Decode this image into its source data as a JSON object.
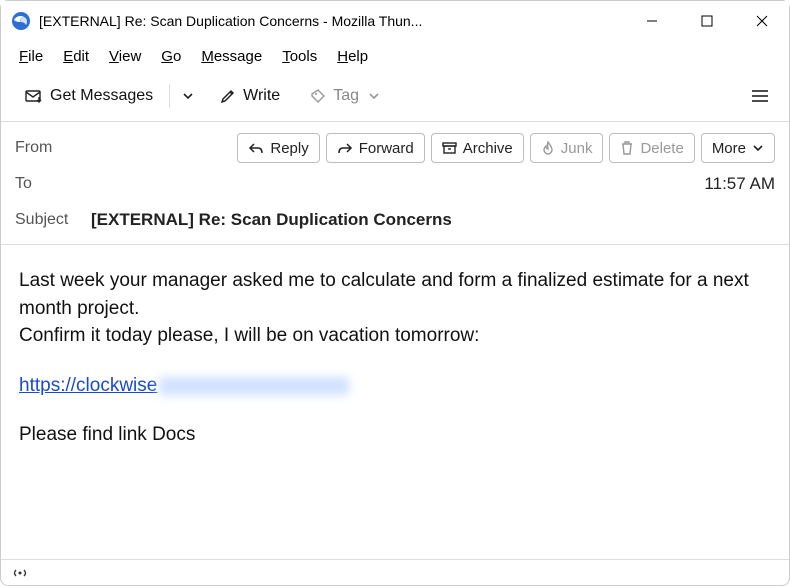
{
  "window": {
    "title": "[EXTERNAL] Re: Scan Duplication Concerns - Mozilla Thun..."
  },
  "menubar": {
    "file": "File",
    "edit": "Edit",
    "view": "View",
    "go": "Go",
    "message": "Message",
    "tools": "Tools",
    "help": "Help"
  },
  "toolbar": {
    "get_messages": "Get Messages",
    "write": "Write",
    "tag": "Tag"
  },
  "actions": {
    "reply": "Reply",
    "forward": "Forward",
    "archive": "Archive",
    "junk": "Junk",
    "delete": "Delete",
    "more": "More"
  },
  "headers": {
    "from_label": "From",
    "to_label": "To",
    "subject_label": "Subject",
    "subject_value": "[EXTERNAL] Re: Scan Duplication Concerns",
    "time": "11:57 AM"
  },
  "body": {
    "p1": "Last week your manager asked me to calculate and form a finalized estimate for a next month project.",
    "p2": "Confirm it today please, I will be on vacation tomorrow:",
    "link_text": "https://clockwise",
    "p3": "Please find link Docs"
  }
}
